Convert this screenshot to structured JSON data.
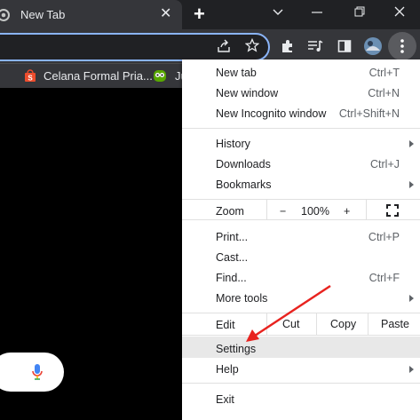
{
  "tab": {
    "title": "New Tab"
  },
  "bookmarks": [
    {
      "label": "Celana Formal Pria..."
    },
    {
      "label": "Ju"
    }
  ],
  "menu": {
    "new_tab": {
      "label": "New tab",
      "shortcut": "Ctrl+T"
    },
    "new_window": {
      "label": "New window",
      "shortcut": "Ctrl+N"
    },
    "new_incognito": {
      "label": "New Incognito window",
      "shortcut": "Ctrl+Shift+N"
    },
    "history": {
      "label": "History"
    },
    "downloads": {
      "label": "Downloads",
      "shortcut": "Ctrl+J"
    },
    "bookmarks": {
      "label": "Bookmarks"
    },
    "zoom": {
      "label": "Zoom",
      "minus": "−",
      "level": "100%",
      "plus": "+"
    },
    "print": {
      "label": "Print...",
      "shortcut": "Ctrl+P"
    },
    "cast": {
      "label": "Cast..."
    },
    "find": {
      "label": "Find...",
      "shortcut": "Ctrl+F"
    },
    "more_tools": {
      "label": "More tools"
    },
    "edit": {
      "label": "Edit",
      "cut": "Cut",
      "copy": "Copy",
      "paste": "Paste"
    },
    "settings": {
      "label": "Settings"
    },
    "help": {
      "label": "Help"
    },
    "exit": {
      "label": "Exit"
    }
  },
  "colors": {
    "accent": "#8ab4f8",
    "annotation_arrow": "#e8231f",
    "menu_bg": "#ffffff"
  }
}
